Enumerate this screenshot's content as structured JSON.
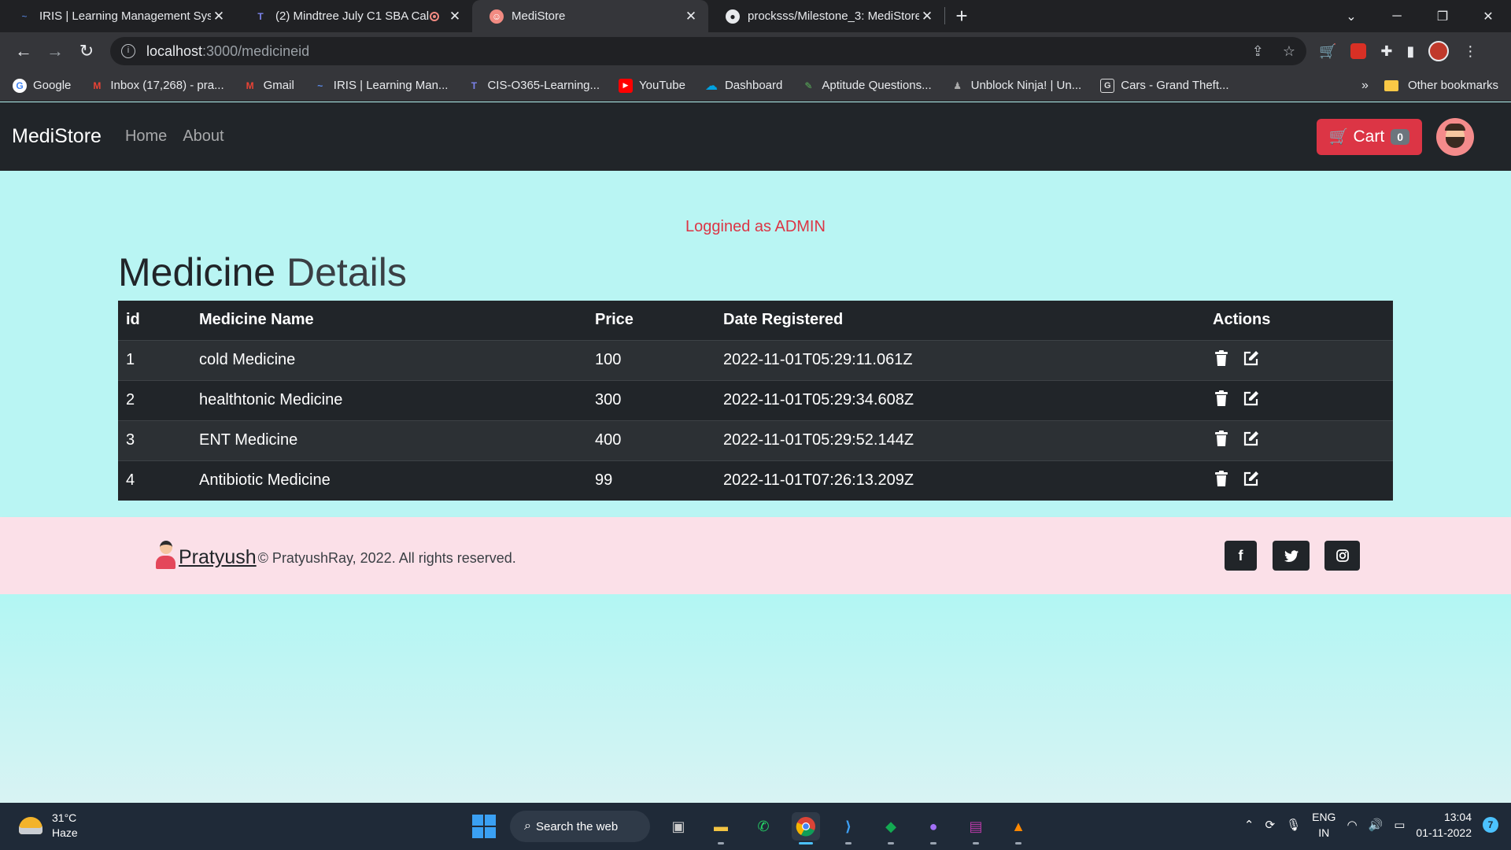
{
  "browser": {
    "tabs": [
      {
        "title": "IRIS | Learning Management Syst",
        "active": false
      },
      {
        "title": "(2) Mindtree July C1 SBA Call",
        "active": false,
        "recording": true
      },
      {
        "title": "MediStore",
        "active": true
      },
      {
        "title": "procksss/Milestone_3: MediStore",
        "active": false
      }
    ],
    "new_tab": "+",
    "address": {
      "host": "localhost",
      "path": ":3000/medicineid"
    },
    "bookmarks": [
      {
        "label": "Google",
        "icon": "G",
        "color": "#4285f4"
      },
      {
        "label": "Inbox (17,268) - pra...",
        "icon": "M",
        "color": "#ea4335"
      },
      {
        "label": "Gmail",
        "icon": "M",
        "color": "#ea4335"
      },
      {
        "label": "IRIS | Learning Man...",
        "icon": "~",
        "color": "#5b8def"
      },
      {
        "label": "CIS-O365-Learning...",
        "icon": "T",
        "color": "#5b5fc7"
      },
      {
        "label": "YouTube",
        "icon": "▶",
        "color": "#ff0000"
      },
      {
        "label": "Dashboard",
        "icon": "☁",
        "color": "#00a1e0"
      },
      {
        "label": "Aptitude Questions...",
        "icon": "✎",
        "color": "#5cb85c"
      },
      {
        "label": "Unblock Ninja! | Un...",
        "icon": "♟",
        "color": "#888888"
      },
      {
        "label": "Cars - Grand Theft...",
        "icon": "G",
        "color": "#dddddd"
      }
    ],
    "bookmarks_more": "»",
    "other_bookmarks": "Other bookmarks"
  },
  "navbar": {
    "brand": "MediStore",
    "links": [
      "Home",
      "About"
    ],
    "cart_label": "Cart",
    "cart_count": "0"
  },
  "main": {
    "admin_message": "Loggined as ADMIN",
    "title_bold": "Medicine",
    "title_light": "Details",
    "table": {
      "headers": [
        "id",
        "Medicine Name",
        "Price",
        "Date Registered",
        "Actions"
      ],
      "rows": [
        {
          "id": "1",
          "name": "cold Medicine",
          "price": "100",
          "date": "2022-11-01T05:29:11.061Z"
        },
        {
          "id": "2",
          "name": "healthtonic Medicine",
          "price": "300",
          "date": "2022-11-01T05:29:34.608Z"
        },
        {
          "id": "3",
          "name": "ENT Medicine",
          "price": "400",
          "date": "2022-11-01T05:29:52.144Z"
        },
        {
          "id": "4",
          "name": "Antibiotic Medicine",
          "price": "99",
          "date": "2022-11-01T07:26:13.209Z"
        }
      ]
    }
  },
  "footer": {
    "name": "Pratyush",
    "copyright": "© PratyushRay, 2022. All rights reserved.",
    "social": [
      "facebook-icon",
      "twitter-icon",
      "instagram-icon"
    ]
  },
  "taskbar": {
    "weather_temp": "31°C",
    "weather_desc": "Haze",
    "search_label": "Search the web",
    "lang_top": "ENG",
    "lang_bottom": "IN",
    "time": "13:04",
    "date": "01-11-2022",
    "notifications": "7"
  },
  "colors": {
    "accent": "#dc3545",
    "navbar_bg": "#212529",
    "page_bg": "#b9f5f3",
    "footer_bg": "#fbe0e8"
  }
}
